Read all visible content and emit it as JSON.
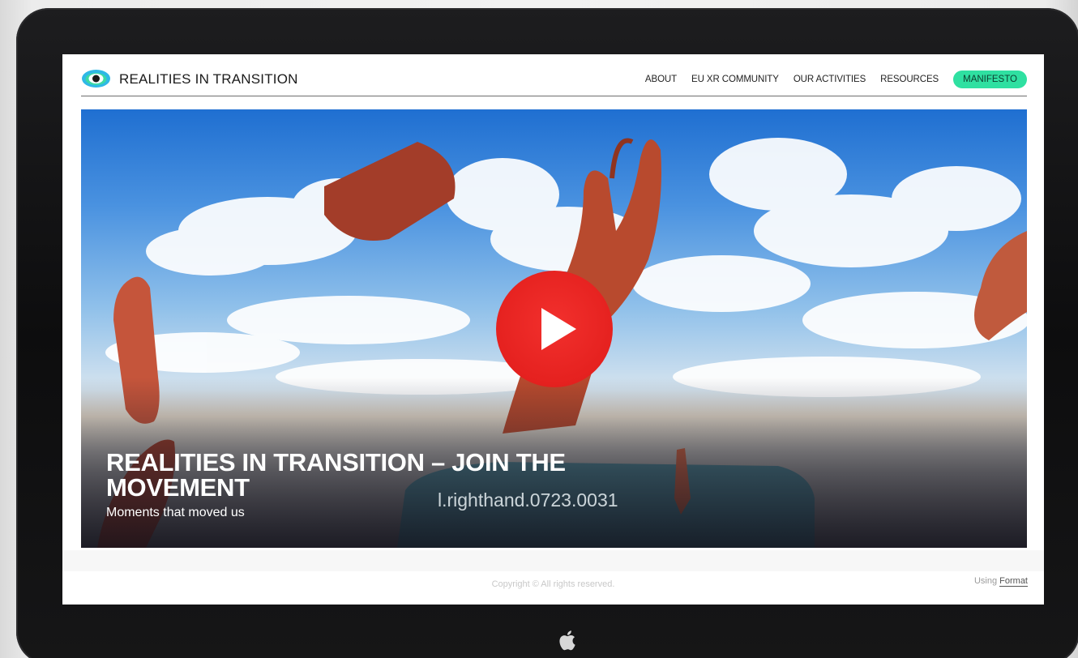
{
  "brand": {
    "name": "REALITIES IN TRANSITION",
    "logo_icon": "eye-logo-icon"
  },
  "nav": {
    "links": [
      "ABOUT",
      "EU XR COMMUNITY",
      "OUR ACTIVITIES",
      "RESOURCES"
    ],
    "cta_label": "MANIFESTO"
  },
  "hero": {
    "title": "REALITIES IN TRANSITION – JOIN THE MOVEMENT",
    "subtitle": "Moments that moved us",
    "overlay_text": "l.righthand.0723.0031",
    "play_icon": "play-icon",
    "prev_arrow": "‹",
    "next_arrow": "›"
  },
  "footer": {
    "copyright": "Copyright © All rights reserved.",
    "using_prefix": "Using",
    "using_link": "Format"
  },
  "colors": {
    "accent": "#2fe0a1",
    "play_red": "#e5211f",
    "bezel": "#111112"
  }
}
